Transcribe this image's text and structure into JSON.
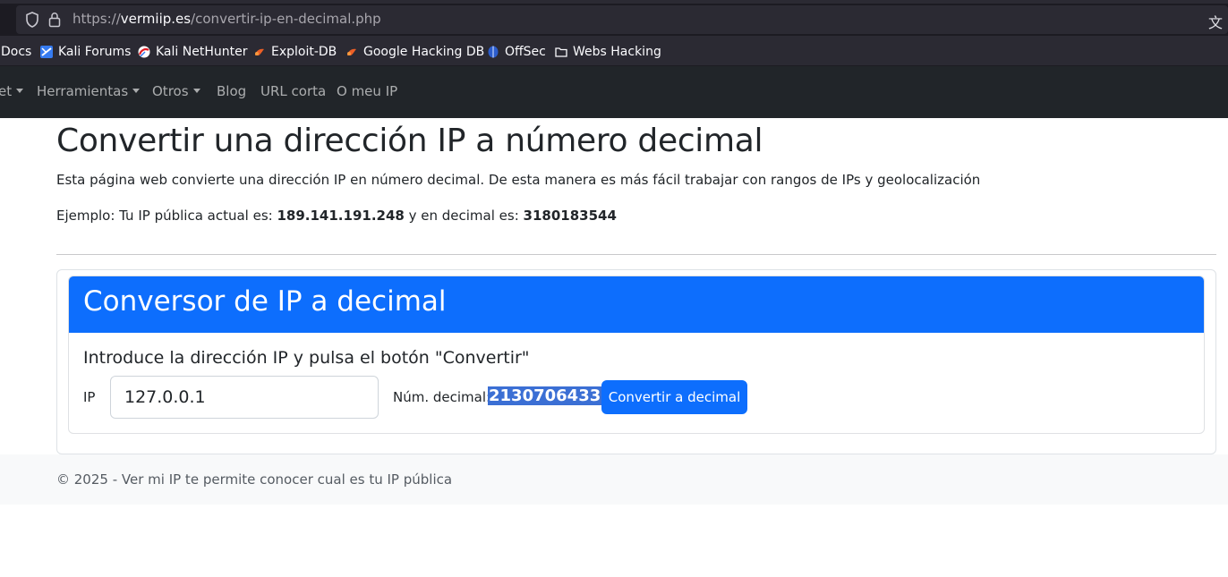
{
  "browser": {
    "url_prefix": "https://",
    "url_host": "vermiip.es",
    "url_path": "/convertir-ip-en-decimal.php"
  },
  "bookmarks": [
    {
      "label": "Docs",
      "icon": "none"
    },
    {
      "label": "Kali Forums",
      "icon": "kali-forums-icon"
    },
    {
      "label": "Kali NetHunter",
      "icon": "kali-nethunter-icon"
    },
    {
      "label": "Exploit-DB",
      "icon": "exploit-db-icon"
    },
    {
      "label": "Google Hacking DB",
      "icon": "ghdb-icon"
    },
    {
      "label": "OffSec",
      "icon": "offsec-icon"
    },
    {
      "label": "Webs Hacking",
      "icon": "folder-icon"
    }
  ],
  "nav": {
    "items": [
      {
        "label": "et",
        "dropdown": true
      },
      {
        "label": "Herramientas",
        "dropdown": true
      },
      {
        "label": "Otros",
        "dropdown": true
      },
      {
        "label": "Blog",
        "dropdown": false
      },
      {
        "label": "URL corta",
        "dropdown": false
      },
      {
        "label": "O meu IP",
        "dropdown": false
      }
    ]
  },
  "page": {
    "title": "Convertir una dirección IP a número decimal",
    "lead": "Esta página web convierte una dirección IP en número decimal. De esta manera es más fácil trabajar con rangos de IPs y geolocalización",
    "example_prefix": "Ejemplo: Tu IP pública actual es: ",
    "example_ip": "189.141.191.248",
    "example_middle": " y en decimal es: ",
    "example_decimal": "3180183544"
  },
  "converter": {
    "header": "Conversor de IP a decimal",
    "instruction": "Introduce la dirección IP y pulsa el botón \"Convertir\"",
    "ip_label": "IP",
    "ip_value": "127.0.0.1",
    "decimal_label": "Núm. decimal:",
    "decimal_value": "2130706433",
    "button_label": "Convertir a decimal"
  },
  "footer": {
    "text": "© 2025 - Ver mi IP te permite conocer cual es tu IP pública"
  },
  "colors": {
    "primary": "#0d6efd",
    "navbar": "#212529",
    "selection": "#3b6fd4"
  }
}
